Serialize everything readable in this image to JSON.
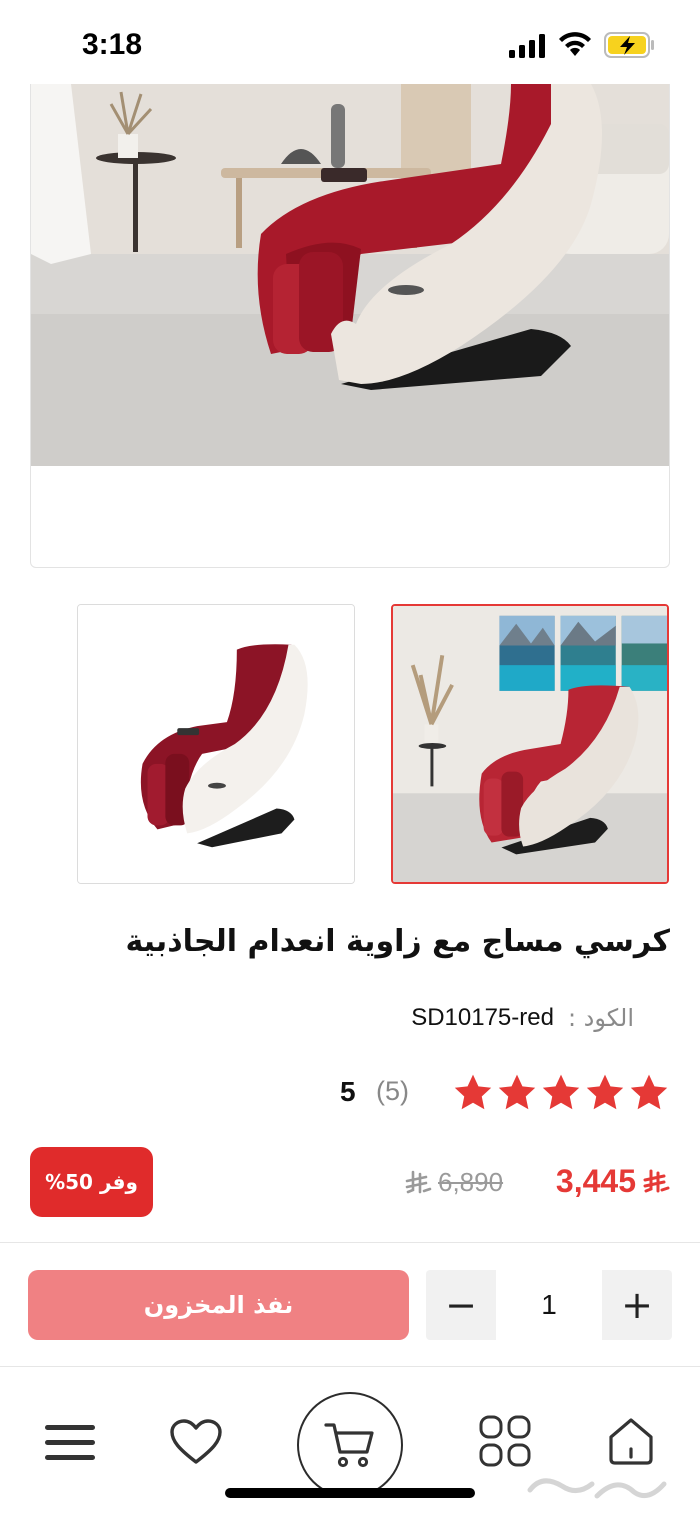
{
  "status_bar": {
    "time": "3:18"
  },
  "gallery": {
    "main_image": "massage-chair-living-room-photo",
    "thumbnails": [
      {
        "image": "massage-chair-white-background",
        "selected": false
      },
      {
        "image": "massage-chair-room-with-lake-paintings",
        "selected": true
      }
    ]
  },
  "product": {
    "title": "كرسي مساج مع زاوية انعدام الجاذبية",
    "code_label": "الكود :",
    "code_value": "SD10175-red",
    "rating_stars": 5,
    "review_count": "(5)",
    "rating_value": "5",
    "price_current": "3,445",
    "price_old": "6,890",
    "discount_label": "وفر 50%"
  },
  "actions": {
    "out_of_stock_label": "نفذ المخزون",
    "quantity": "1",
    "minus_symbol": "−",
    "plus_symbol": "+"
  },
  "bottom_nav": {
    "items": [
      "menu-icon",
      "heart-icon",
      "cart-icon",
      "categories-icon",
      "home-icon"
    ]
  },
  "colors": {
    "accent": "#e53936",
    "badge": "#e02b2b",
    "out_of_stock_button": "#f08183",
    "chair_red": "#a8192a"
  }
}
